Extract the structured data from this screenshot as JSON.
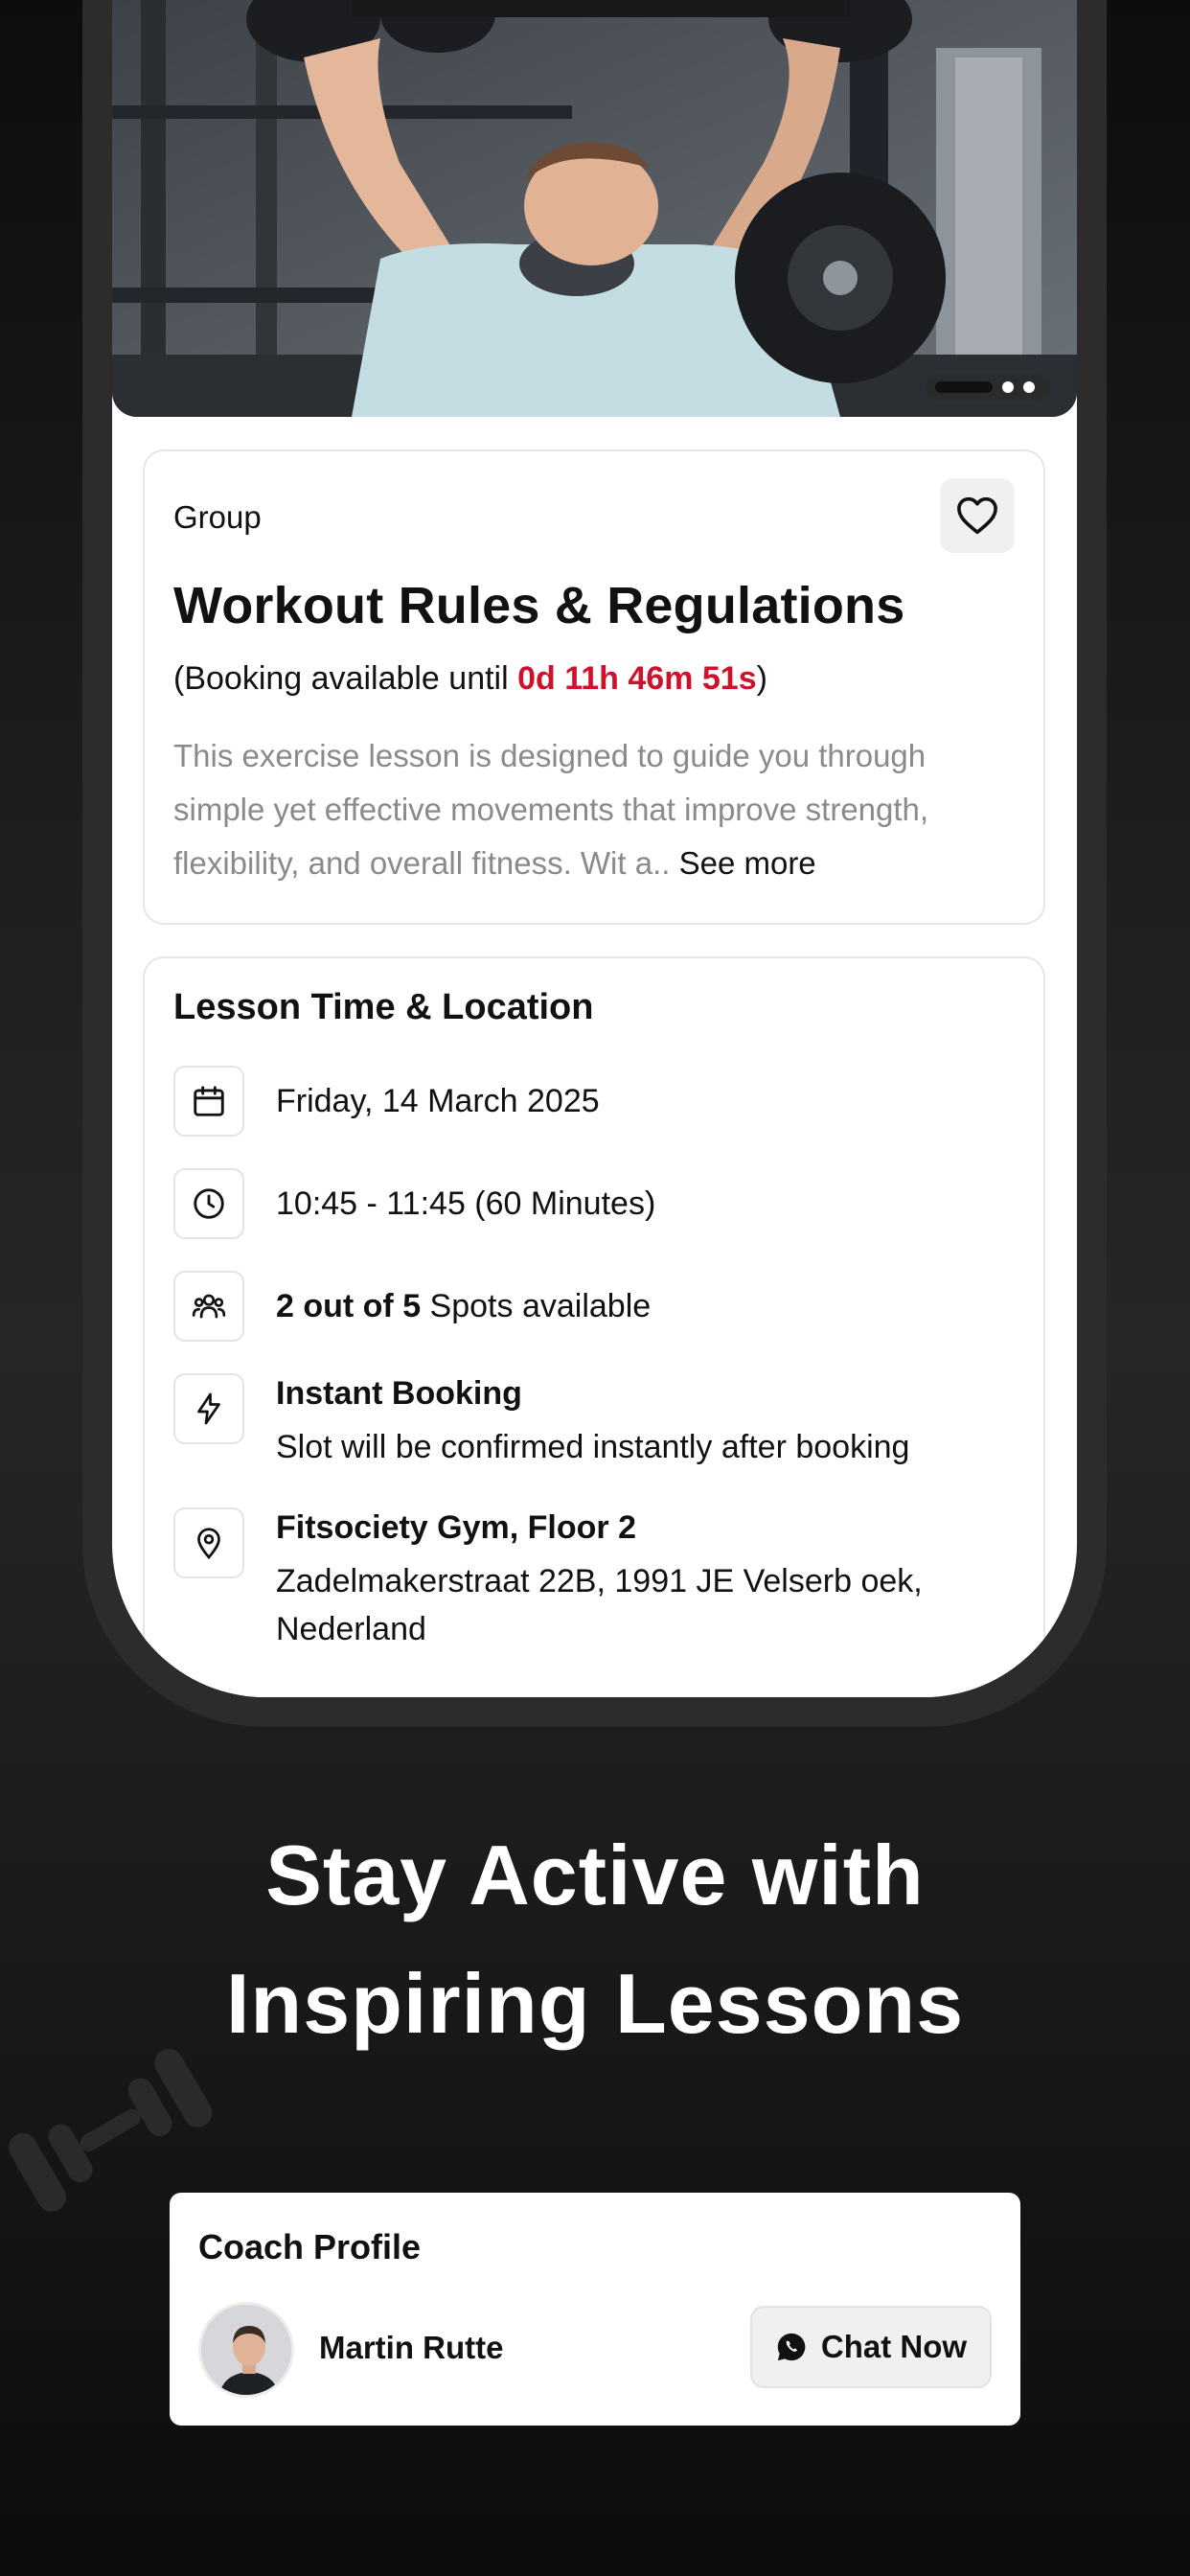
{
  "lesson": {
    "category": "Group",
    "title": "Workout Rules & Regulations",
    "booking_prefix": "(Booking available until ",
    "booking_countdown": "0d 11h 46m 51s",
    "booking_suffix": ")",
    "description": "This exercise lesson is designed to guide you through simple yet effective movements that improve strength, flexibility, and overall fitness. Wit a.. ",
    "see_more": "See more",
    "favorite_icon": "heart-outline-icon",
    "image_pager": {
      "pages": 3,
      "active_index": 0
    }
  },
  "time_location": {
    "section_title": "Lesson Time & Location",
    "date": "Friday, 14 March 2025",
    "time": "10:45 - 11:45 (60 Minutes)",
    "spots_bold": "2 out of 5",
    "spots_rest": " Spots available",
    "instant_title": "Instant Booking",
    "instant_desc": "Slot will be confirmed instantly after booking",
    "gym_name": "Fitsociety Gym, Floor 2",
    "address": "Zadelmakerstraat 22B, 1991 JE Velserb oek, Nederland"
  },
  "headline": {
    "line1": "Stay Active with",
    "line2": "Inspiring Lessons"
  },
  "coach": {
    "section_title": "Coach Profile",
    "name": "Martin Rutte",
    "chat_label": "Chat Now"
  },
  "colors": {
    "accent_red": "#d0112b",
    "background_dark": "#1f1f1f",
    "card_white": "#ffffff"
  }
}
